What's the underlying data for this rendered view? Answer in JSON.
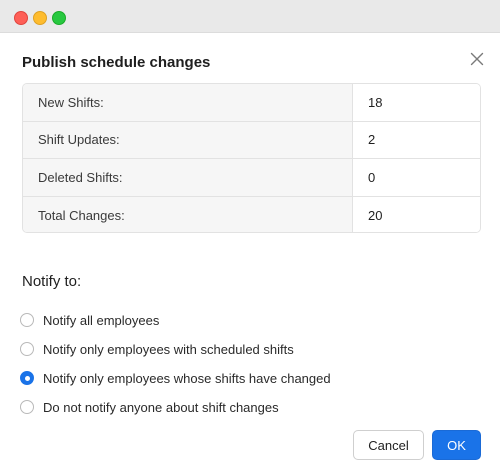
{
  "dialog": {
    "title": "Publish schedule changes",
    "close_icon": "close-icon"
  },
  "summary": {
    "rows": [
      {
        "label": "New Shifts:",
        "value": "18"
      },
      {
        "label": "Shift Updates:",
        "value": "2"
      },
      {
        "label": "Deleted Shifts:",
        "value": "0"
      },
      {
        "label": "Total Changes:",
        "value": "20"
      }
    ]
  },
  "notify": {
    "heading": "Notify to:",
    "options": [
      {
        "label": "Notify all employees",
        "selected": false
      },
      {
        "label": "Notify only employees with scheduled shifts",
        "selected": false
      },
      {
        "label": "Notify only employees whose shifts have changed",
        "selected": true
      },
      {
        "label": "Do not notify anyone about shift changes",
        "selected": false
      }
    ]
  },
  "buttons": {
    "cancel": "Cancel",
    "ok": "OK"
  },
  "colors": {
    "accent": "#1a73e8",
    "close_red": "#fe5f57",
    "minimize_yellow": "#febc2e",
    "zoom_green": "#28c840"
  }
}
